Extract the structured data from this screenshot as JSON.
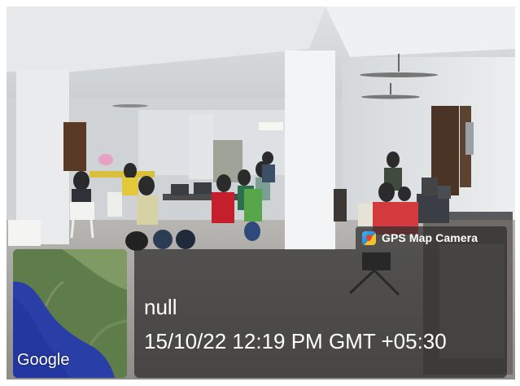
{
  "overlay": {
    "app_label": "GPS Map Camera",
    "app_icon": "gps-map-camera-icon",
    "place_name": "null",
    "datetime": "15/10/22 12:19 PM GMT +05:30",
    "map_attribution": "Google"
  },
  "colors": {
    "panel_bg": "#2d2d2d",
    "text": "#ffffff",
    "map_sea": "#2a3ea8",
    "map_land": "#5f7d4a"
  }
}
